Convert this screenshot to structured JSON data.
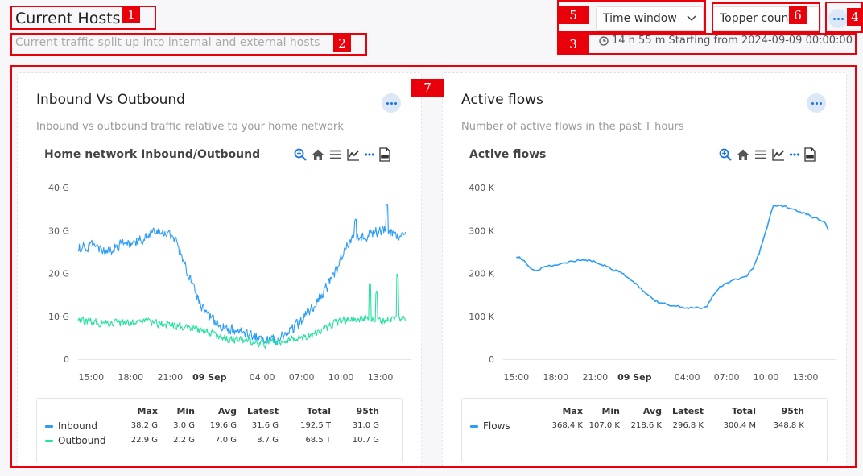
{
  "header": {
    "title": "Current Hosts",
    "subtitle": "Current traffic split up into internal and external hosts",
    "time_window_label": "Time window",
    "topper_count_label": "Topper count",
    "time_range": "14 h 55 m Starting from 2024-09-09 00:00:00"
  },
  "markers": [
    "1",
    "2",
    "3",
    "4",
    "5",
    "6",
    "7"
  ],
  "colors": {
    "accent": "#1a73e8",
    "inbound": "#2e9df7",
    "outbound": "#26e1a0",
    "flows": "#2e9df7",
    "marker": "#e8000b"
  },
  "icons": [
    "chevron-down-icon",
    "clock-icon",
    "more-dots-icon",
    "zoom-icon",
    "home-icon",
    "menu-icon",
    "line-chart-icon",
    "pdf-icon"
  ],
  "cards": [
    {
      "title": "Inbound Vs Outbound",
      "description": "Inbound vs outbound traffic relative to your home network",
      "chart_title": "Home network Inbound/Outbound",
      "legend": {
        "headers": [
          "Max",
          "Min",
          "Avg",
          "Latest",
          "Total",
          "95th"
        ],
        "rows": [
          {
            "name": "Inbound",
            "values": [
              "38.2 G",
              "3.0 G",
              "19.6 G",
              "31.6 G",
              "192.5 T",
              "31.0 G"
            ]
          },
          {
            "name": "Outbound",
            "values": [
              "22.9 G",
              "2.2 G",
              "7.0 G",
              "8.7 G",
              "68.5 T",
              "10.7 G"
            ]
          }
        ]
      }
    },
    {
      "title": "Active flows",
      "description": "Number of active flows in the past T hours",
      "chart_title": "Active flows",
      "legend": {
        "headers": [
          "Max",
          "Min",
          "Avg",
          "Latest",
          "Total",
          "95th"
        ],
        "rows": [
          {
            "name": "Flows",
            "values": [
              "368.4 K",
              "107.0 K",
              "218.6 K",
              "296.8 K",
              "300.4 M",
              "348.8 K"
            ]
          }
        ]
      }
    }
  ],
  "chart_data": [
    {
      "type": "line",
      "title": "Home network Inbound/Outbound",
      "x_tick_labels": [
        "15:00",
        "18:00",
        "21:00",
        "09 Sep",
        "04:00",
        "07:00",
        "10:00",
        "13:00"
      ],
      "x_range_hours": [
        -10,
        14.9
      ],
      "x_ticks_hours": [
        -9,
        -6,
        -3,
        0,
        4,
        7,
        10,
        13
      ],
      "y_tick_labels": [
        "0",
        "10 G",
        "20 G",
        "30 G",
        "40 G"
      ],
      "y_ticks": [
        0,
        10,
        20,
        30,
        40
      ],
      "ylim": [
        0,
        40
      ],
      "unit": "G",
      "series": [
        {
          "name": "Inbound",
          "points": [
            [
              -10,
              26
            ],
            [
              -9,
              26.5
            ],
            [
              -8,
              25
            ],
            [
              -7,
              26.5
            ],
            [
              -6,
              27
            ],
            [
              -5,
              28
            ],
            [
              -4,
              29.5
            ],
            [
              -3,
              29
            ],
            [
              -2.5,
              27
            ],
            [
              -2,
              23
            ],
            [
              -1.3,
              18
            ],
            [
              -0.7,
              13
            ],
            [
              0,
              10
            ],
            [
              0.5,
              8
            ],
            [
              1,
              7.5
            ],
            [
              1.5,
              7
            ],
            [
              2,
              6.5
            ],
            [
              3,
              5.5
            ],
            [
              4,
              5
            ],
            [
              4.5,
              4.5
            ],
            [
              5,
              4.5
            ],
            [
              6,
              6
            ],
            [
              7,
              9
            ],
            [
              8,
              13
            ],
            [
              9,
              17
            ],
            [
              9.7,
              21
            ],
            [
              10.3,
              26
            ],
            [
              11,
              28.5
            ],
            [
              12,
              29
            ],
            [
              13,
              30
            ],
            [
              13.5,
              30.5
            ],
            [
              14,
              29
            ],
            [
              14.6,
              29
            ],
            [
              14.9,
              29.5
            ]
          ],
          "noise": 1.8
        },
        {
          "name": "Outbound",
          "points": [
            [
              -10,
              9
            ],
            [
              -8,
              8.5
            ],
            [
              -6,
              8.5
            ],
            [
              -4,
              8.5
            ],
            [
              -3,
              8
            ],
            [
              -2,
              7.5
            ],
            [
              -1,
              7
            ],
            [
              0,
              6
            ],
            [
              1,
              5
            ],
            [
              2,
              4.5
            ],
            [
              3,
              4
            ],
            [
              4,
              3.5
            ],
            [
              5,
              4
            ],
            [
              6,
              4.5
            ],
            [
              7,
              5
            ],
            [
              8,
              6
            ],
            [
              9,
              7.5
            ],
            [
              10,
              9
            ],
            [
              11,
              9.5
            ],
            [
              12,
              9.5
            ],
            [
              13,
              9
            ],
            [
              14,
              9.5
            ],
            [
              14.9,
              9.5
            ]
          ],
          "noise": 1.3
        }
      ]
    },
    {
      "type": "line",
      "title": "Active flows",
      "x_tick_labels": [
        "15:00",
        "18:00",
        "21:00",
        "09 Sep",
        "04:00",
        "07:00",
        "10:00",
        "13:00"
      ],
      "x_range_hours": [
        -9,
        14.9
      ],
      "x_ticks_hours": [
        -9,
        -6,
        -3,
        0,
        4,
        7,
        10,
        13
      ],
      "y_tick_labels": [
        "0",
        "100 K",
        "200 K",
        "300 K",
        "400 K"
      ],
      "y_ticks": [
        0,
        100,
        200,
        300,
        400
      ],
      "ylim": [
        0,
        400
      ],
      "unit": "K",
      "series": [
        {
          "name": "Flows",
          "points": [
            [
              -9,
              240
            ],
            [
              -8.4,
              232
            ],
            [
              -8,
              212
            ],
            [
              -7.5,
              208
            ],
            [
              -7,
              214
            ],
            [
              -6,
              218
            ],
            [
              -5,
              226
            ],
            [
              -4,
              232
            ],
            [
              -3,
              228
            ],
            [
              -2,
              215
            ],
            [
              -1,
              200
            ],
            [
              0,
              178
            ],
            [
              1,
              150
            ],
            [
              1.5,
              138
            ],
            [
              2,
              130
            ],
            [
              2.5,
              128
            ],
            [
              3,
              125
            ],
            [
              3.5,
              121
            ],
            [
              4,
              118
            ],
            [
              5,
              118
            ],
            [
              5.5,
              122
            ],
            [
              6,
              150
            ],
            [
              6.5,
              168
            ],
            [
              7,
              178
            ],
            [
              8,
              188
            ],
            [
              8.5,
              193
            ],
            [
              9,
              210
            ],
            [
              9.5,
              250
            ],
            [
              10,
              300
            ],
            [
              10.5,
              355
            ],
            [
              11,
              362
            ],
            [
              12,
              350
            ],
            [
              13,
              340
            ],
            [
              14,
              326
            ],
            [
              14.5,
              318
            ],
            [
              14.8,
              296
            ]
          ],
          "noise": 4
        }
      ]
    }
  ]
}
